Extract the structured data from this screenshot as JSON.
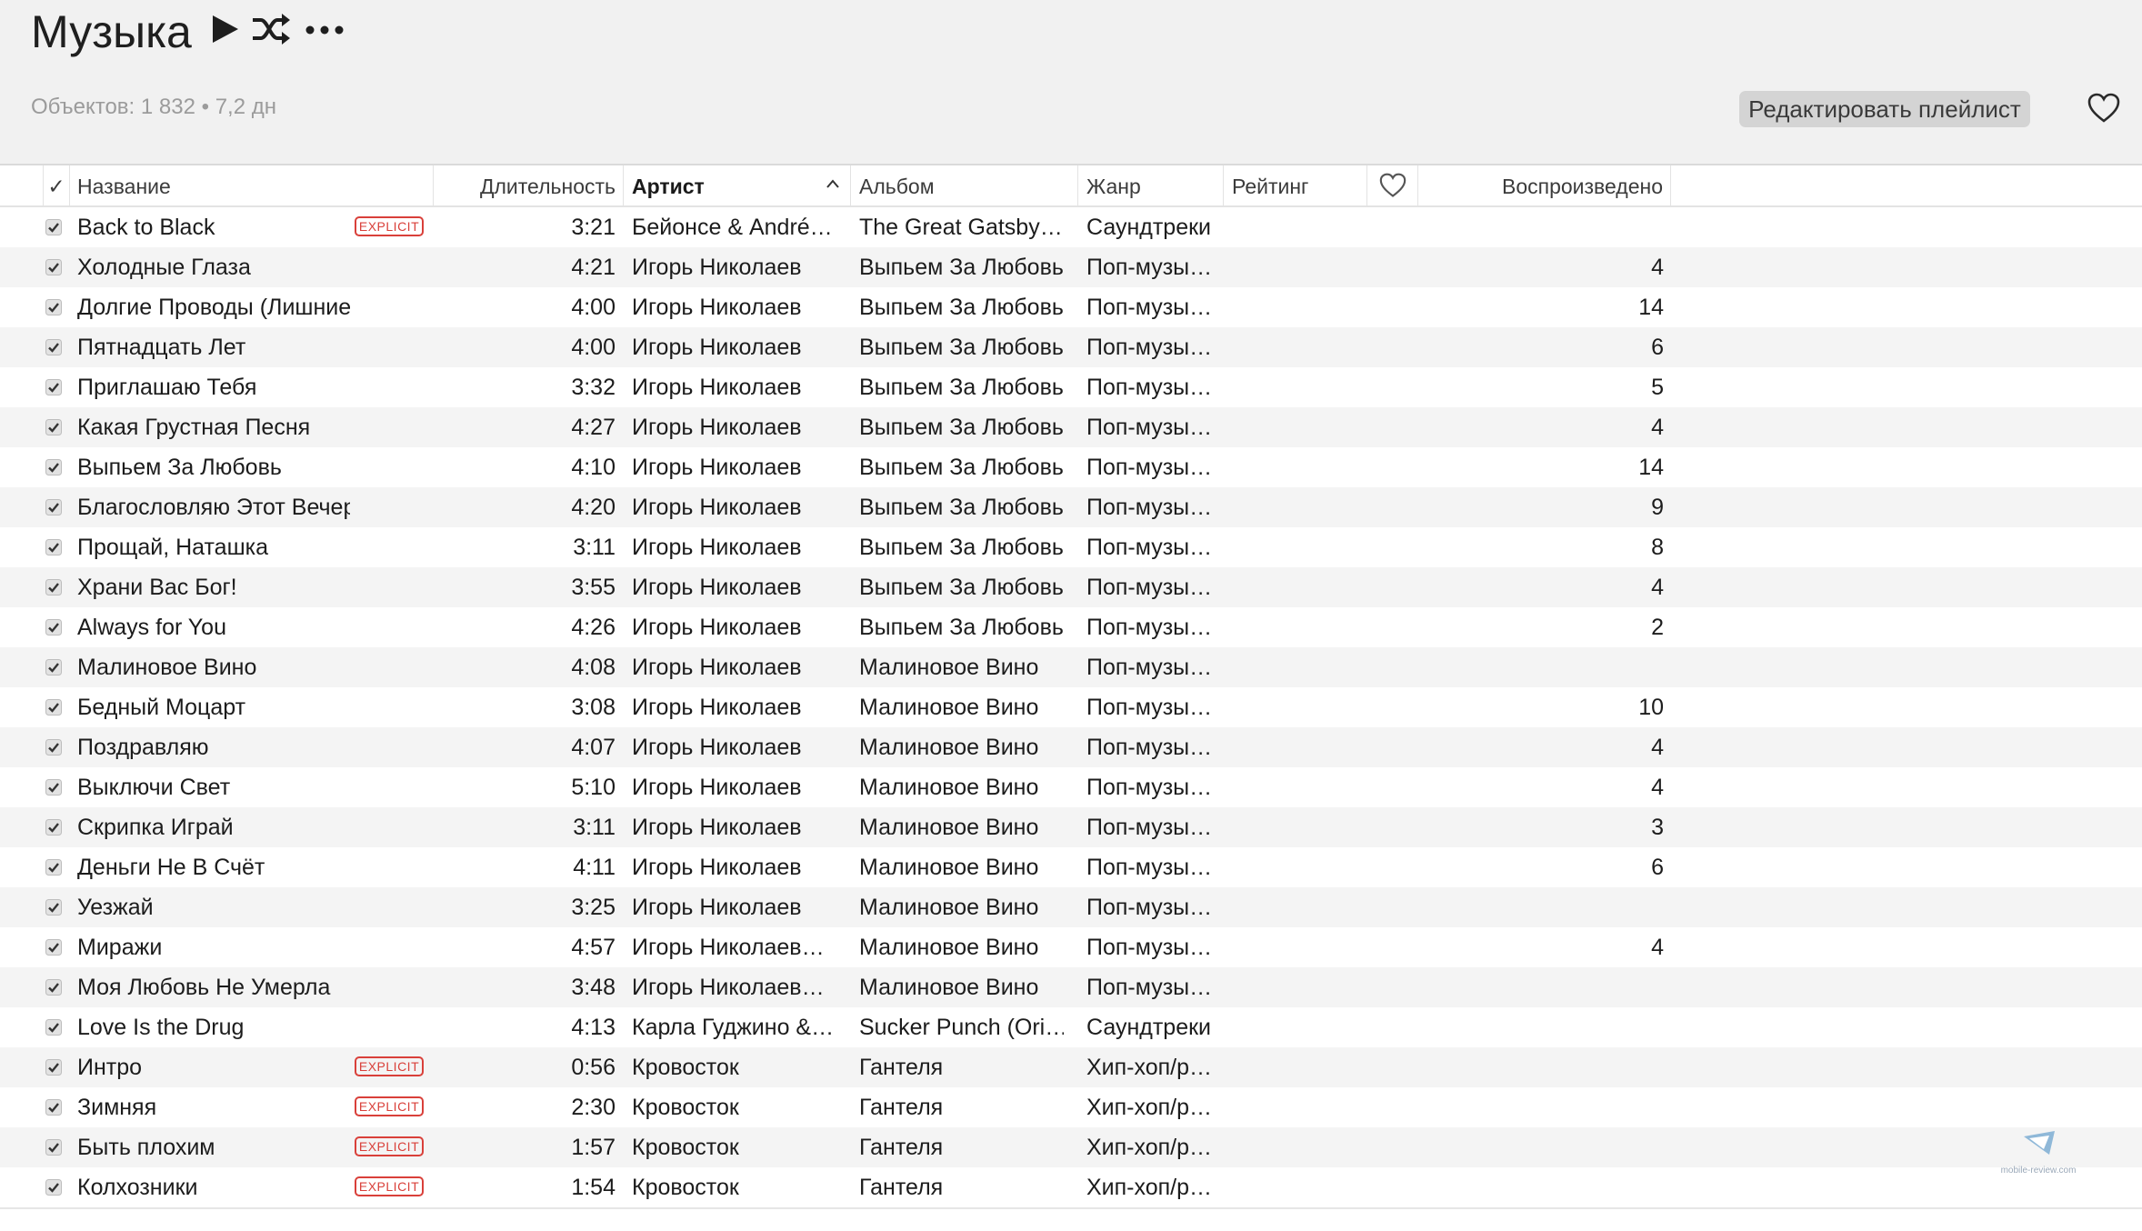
{
  "header": {
    "title": "Музыка",
    "summary": "Объектов: 1 832 • 7,2 дн",
    "edit_playlist_label": "Редактировать плейлист",
    "icons": {
      "play": "play-icon",
      "shuffle": "shuffle-icon",
      "more": "more-icon",
      "favorite": "heart-icon"
    }
  },
  "columns": {
    "check": "✓",
    "name": "Название",
    "duration": "Длительность",
    "artist": "Артист",
    "album": "Альбом",
    "genre": "Жанр",
    "rating": "Рейтинг",
    "plays": "Воспроизведено"
  },
  "explicit_label": "EXPLICIT",
  "accent_explicit": "#d9403a",
  "tracks": [
    {
      "name": "Back to Black",
      "explicit": true,
      "duration": "3:21",
      "artist": "Бейонсе & André…",
      "album": "The Great Gatsby…",
      "genre": "Саундтреки",
      "plays": ""
    },
    {
      "name": "Холодные Глаза",
      "explicit": false,
      "duration": "4:21",
      "artist": "Игорь Николаев",
      "album": "Выпьем За Любовь",
      "genre": "Поп-музы…",
      "plays": "4"
    },
    {
      "name": "Долгие Проводы (Лишние Слё…",
      "explicit": false,
      "duration": "4:00",
      "artist": "Игорь Николаев",
      "album": "Выпьем За Любовь",
      "genre": "Поп-музы…",
      "plays": "14"
    },
    {
      "name": "Пятнадцать Лет",
      "explicit": false,
      "duration": "4:00",
      "artist": "Игорь Николаев",
      "album": "Выпьем За Любовь",
      "genre": "Поп-музы…",
      "plays": "6"
    },
    {
      "name": "Приглашаю Тебя",
      "explicit": false,
      "duration": "3:32",
      "artist": "Игорь Николаев",
      "album": "Выпьем За Любовь",
      "genre": "Поп-музы…",
      "plays": "5"
    },
    {
      "name": "Какая Грустная Песня",
      "explicit": false,
      "duration": "4:27",
      "artist": "Игорь Николаев",
      "album": "Выпьем За Любовь",
      "genre": "Поп-музы…",
      "plays": "4"
    },
    {
      "name": "Выпьем За Любовь",
      "explicit": false,
      "duration": "4:10",
      "artist": "Игорь Николаев",
      "album": "Выпьем За Любовь",
      "genre": "Поп-музы…",
      "plays": "14"
    },
    {
      "name": "Благословляю Этот Вечер",
      "explicit": false,
      "duration": "4:20",
      "artist": "Игорь Николаев",
      "album": "Выпьем За Любовь",
      "genre": "Поп-музы…",
      "plays": "9"
    },
    {
      "name": "Прощай, Наташка",
      "explicit": false,
      "duration": "3:11",
      "artist": "Игорь Николаев",
      "album": "Выпьем За Любовь",
      "genre": "Поп-музы…",
      "plays": "8"
    },
    {
      "name": "Храни Вас Бог!",
      "explicit": false,
      "duration": "3:55",
      "artist": "Игорь Николаев",
      "album": "Выпьем За Любовь",
      "genre": "Поп-музы…",
      "plays": "4"
    },
    {
      "name": "Always for You",
      "explicit": false,
      "duration": "4:26",
      "artist": "Игорь Николаев",
      "album": "Выпьем За Любовь",
      "genre": "Поп-музы…",
      "plays": "2"
    },
    {
      "name": "Малиновое Вино",
      "explicit": false,
      "duration": "4:08",
      "artist": "Игорь Николаев",
      "album": "Малиновое Вино",
      "genre": "Поп-музы…",
      "plays": ""
    },
    {
      "name": "Бедный Моцарт",
      "explicit": false,
      "duration": "3:08",
      "artist": "Игорь Николаев",
      "album": "Малиновое Вино",
      "genre": "Поп-музы…",
      "plays": "10"
    },
    {
      "name": "Поздравляю",
      "explicit": false,
      "duration": "4:07",
      "artist": "Игорь Николаев",
      "album": "Малиновое Вино",
      "genre": "Поп-музы…",
      "plays": "4"
    },
    {
      "name": "Выключи Свет",
      "explicit": false,
      "duration": "5:10",
      "artist": "Игорь Николаев",
      "album": "Малиновое Вино",
      "genre": "Поп-музы…",
      "plays": "4"
    },
    {
      "name": "Скрипка Играй",
      "explicit": false,
      "duration": "3:11",
      "artist": "Игорь Николаев",
      "album": "Малиновое Вино",
      "genre": "Поп-музы…",
      "plays": "3"
    },
    {
      "name": "Деньги Не В Счёт",
      "explicit": false,
      "duration": "4:11",
      "artist": "Игорь Николаев",
      "album": "Малиновое Вино",
      "genre": "Поп-музы…",
      "plays": "6"
    },
    {
      "name": "Уезжай",
      "explicit": false,
      "duration": "3:25",
      "artist": "Игорь Николаев",
      "album": "Малиновое Вино",
      "genre": "Поп-музы…",
      "plays": ""
    },
    {
      "name": "Миражи",
      "explicit": false,
      "duration": "4:57",
      "artist": "Игорь Николаев…",
      "album": "Малиновое Вино",
      "genre": "Поп-музы…",
      "plays": "4"
    },
    {
      "name": "Моя Любовь Не Умерла",
      "explicit": false,
      "duration": "3:48",
      "artist": "Игорь Николаев…",
      "album": "Малиновое Вино",
      "genre": "Поп-музы…",
      "plays": ""
    },
    {
      "name": "Love Is the Drug",
      "explicit": false,
      "duration": "4:13",
      "artist": "Карла Гуджино &…",
      "album": "Sucker Punch (Ori…",
      "genre": "Саундтреки",
      "plays": ""
    },
    {
      "name": "Интро",
      "explicit": true,
      "duration": "0:56",
      "artist": "Кровосток",
      "album": "Гантеля",
      "genre": "Хип-хоп/р…",
      "plays": ""
    },
    {
      "name": "Зимняя",
      "explicit": true,
      "duration": "2:30",
      "artist": "Кровосток",
      "album": "Гантеля",
      "genre": "Хип-хоп/р…",
      "plays": ""
    },
    {
      "name": "Быть плохим",
      "explicit": true,
      "duration": "1:57",
      "artist": "Кровосток",
      "album": "Гантеля",
      "genre": "Хип-хоп/р…",
      "plays": ""
    },
    {
      "name": "Колхозники",
      "explicit": true,
      "duration": "1:54",
      "artist": "Кровосток",
      "album": "Гантеля",
      "genre": "Хип-хоп/р…",
      "plays": ""
    }
  ],
  "watermark": "mobile-review.com"
}
